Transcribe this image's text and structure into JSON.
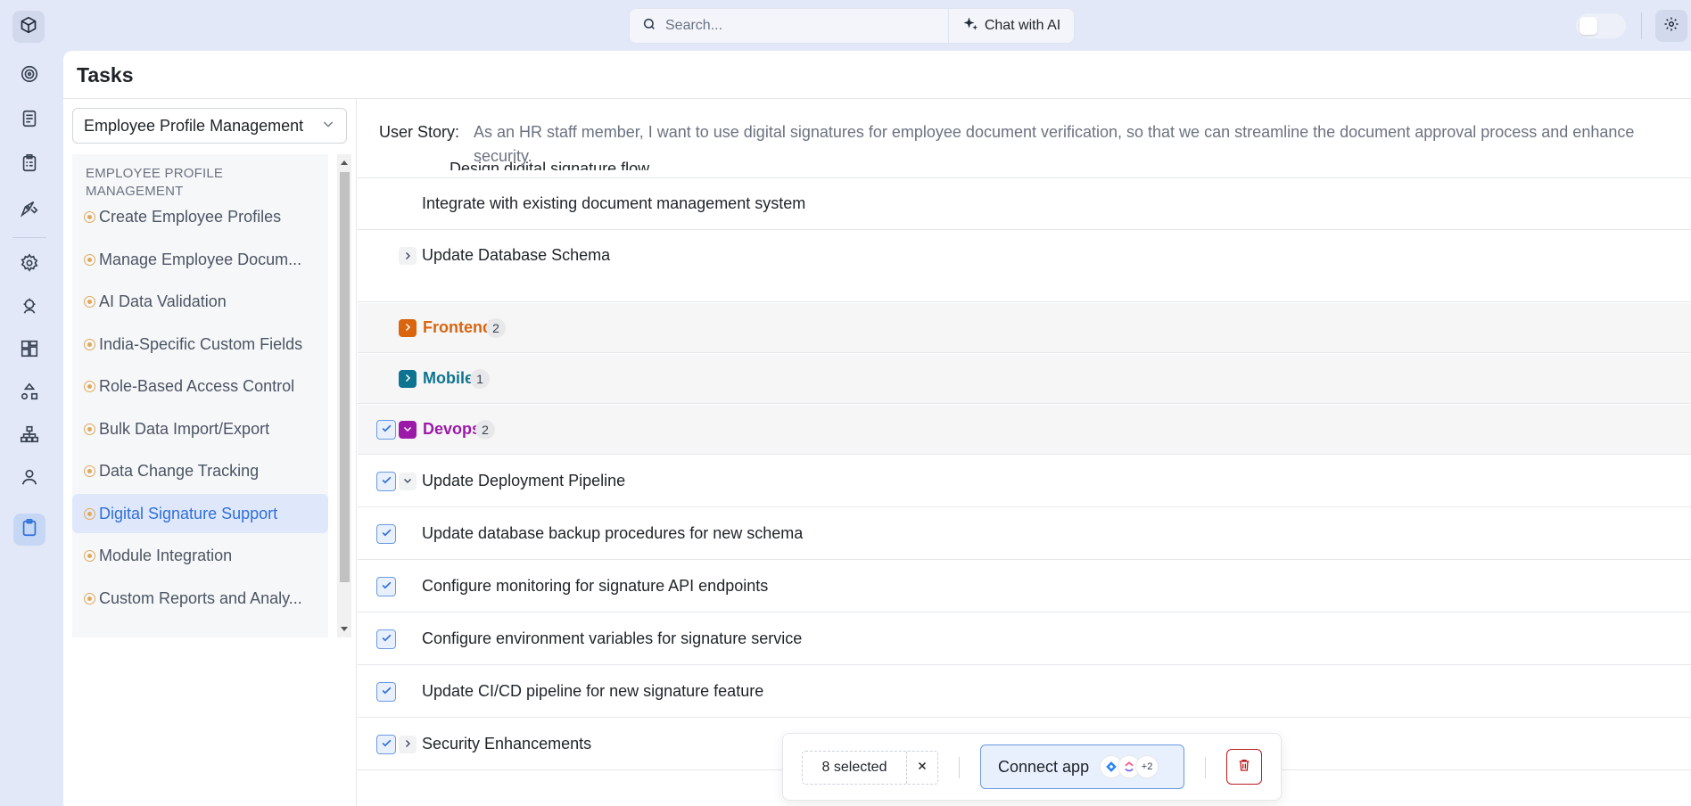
{
  "topbar": {
    "search_placeholder": "Search...",
    "chat_ai_label": "Chat with AI"
  },
  "page": {
    "title": "Tasks"
  },
  "sidebar": {
    "dropdown_value": "Employee Profile Management",
    "group_label": "EMPLOYEE PROFILE MANAGEMENT",
    "items": [
      {
        "label": "Create Employee Profiles",
        "active": false
      },
      {
        "label": "Manage Employee Docum...",
        "active": false
      },
      {
        "label": "AI Data Validation",
        "active": false
      },
      {
        "label": "India-Specific Custom Fields",
        "active": false
      },
      {
        "label": "Role-Based Access Control",
        "active": false
      },
      {
        "label": "Bulk Data Import/Export",
        "active": false
      },
      {
        "label": "Data Change Tracking",
        "active": false
      },
      {
        "label": "Digital Signature Support",
        "active": true
      },
      {
        "label": "Module Integration",
        "active": false
      },
      {
        "label": "Custom Reports and Analy...",
        "active": false
      }
    ]
  },
  "story": {
    "label": "User Story:",
    "text": "As an HR staff member, I want to use digital signatures for employee document verification, so that we can streamline the document approval process and enhance security.",
    "cut_off_text": "Design digital signature flow"
  },
  "tasks": {
    "integrate": "Integrate with existing document management system",
    "update_db_schema": "Update Database Schema",
    "groups": {
      "frontend": {
        "name": "Frontend",
        "count": "2",
        "color": "#d9650f"
      },
      "mobile": {
        "name": "Mobile",
        "count": "1",
        "color": "#0e7490"
      },
      "devops": {
        "name": "Devops",
        "count": "2",
        "color": "#9c1aa8"
      }
    },
    "devops_rows": [
      "Update Deployment Pipeline",
      "Update database backup procedures for new schema",
      "Configure monitoring for signature API endpoints",
      "Configure environment variables for signature service",
      "Update CI/CD pipeline for new signature feature",
      "Security Enhancements"
    ]
  },
  "action_bar": {
    "selected_text": "8 selected",
    "connect_label": "Connect app",
    "more_apps": "+2"
  },
  "colors": {
    "accent": "#2f6fdb",
    "checkbox": "#6b9ae0",
    "danger": "#b91c1c",
    "nav_dot": "#e0a85a"
  }
}
